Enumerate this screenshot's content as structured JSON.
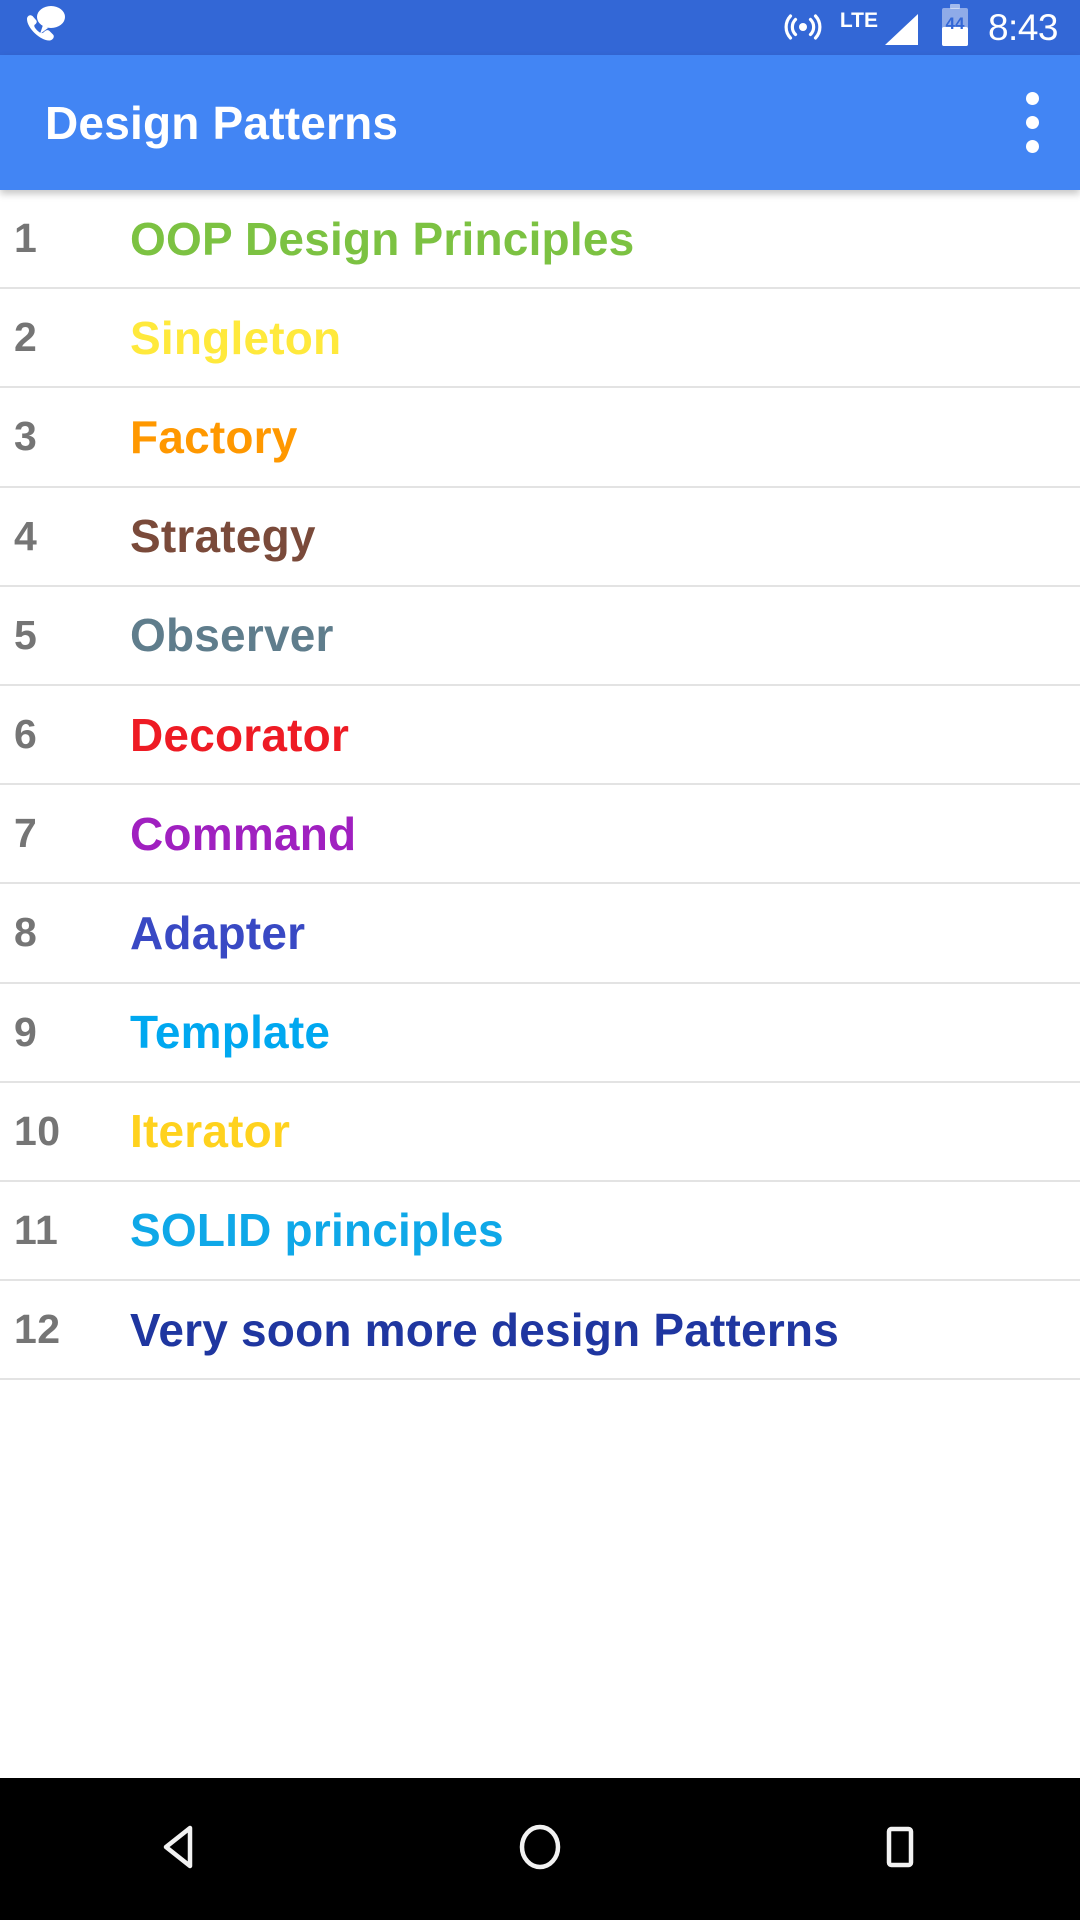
{
  "status_bar": {
    "background_color": "#3367D6",
    "clock": "8:43",
    "notification_icon": "phone-message-icon",
    "icons": [
      "hotspot-icon",
      "lte-signal-icon",
      "battery-icon"
    ],
    "network_label": "LTE",
    "battery_level": "44"
  },
  "app_bar": {
    "background_color": "#4285F4",
    "title": "Design Patterns",
    "overflow_menu_label": "More options"
  },
  "list": {
    "number_color": "#757575",
    "divider_color": "#E3E3E3",
    "rows": [
      {
        "number": "1",
        "label": "OOP Design Principles",
        "color": "#7CC242"
      },
      {
        "number": "2",
        "label": "Singleton",
        "color": "#FFE93C"
      },
      {
        "number": "3",
        "label": "Factory",
        "color": "#FF9800"
      },
      {
        "number": "4",
        "label": "Strategy",
        "color": "#7A4A3A"
      },
      {
        "number": "5",
        "label": "Observer",
        "color": "#5F7D8C"
      },
      {
        "number": "6",
        "label": "Decorator",
        "color": "#EE1B24"
      },
      {
        "number": "7",
        "label": "Command",
        "color": "#A020C0"
      },
      {
        "number": "8",
        "label": "Adapter",
        "color": "#3949C4"
      },
      {
        "number": "9",
        "label": "Template",
        "color": "#00A8F0"
      },
      {
        "number": "10",
        "label": "Iterator",
        "color": "#FFD21E"
      },
      {
        "number": "11",
        "label": "SOLID principles",
        "color": "#0FA8E8"
      },
      {
        "number": "12",
        "label": "Very soon more design Patterns",
        "color": "#1F36A0"
      }
    ]
  },
  "nav_bar": {
    "background_color": "#000000",
    "buttons": [
      {
        "name": "back-button",
        "icon": "triangle-back-icon"
      },
      {
        "name": "home-button",
        "icon": "circle-home-icon"
      },
      {
        "name": "recents-button",
        "icon": "square-recents-icon"
      }
    ]
  }
}
